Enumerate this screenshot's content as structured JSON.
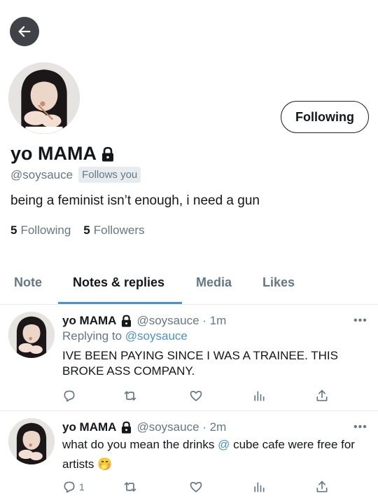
{
  "header": {
    "back_icon": "arrow-left-icon"
  },
  "profile": {
    "display_name": "yo MAMA",
    "locked_icon": "lock-icon",
    "handle": "@soysauce",
    "follows_you": "Follows you",
    "bio": "being a feminist isn’t enough, i need a gun",
    "following_count": "5",
    "following_label": "Following",
    "followers_count": "5",
    "followers_label": "Followers",
    "follow_button": "Following"
  },
  "tabs": [
    {
      "label": "Note",
      "active": false
    },
    {
      "label": "Notes & replies",
      "active": true
    },
    {
      "label": "Media",
      "active": false
    },
    {
      "label": "Likes",
      "active": false
    }
  ],
  "tweets": [
    {
      "name": "yo MAMA",
      "meta": "@soysauce · 1m",
      "reply_prefix": "Replying to",
      "reply_handle": "@soysauce",
      "text": "IVE BEEN PAYING SINCE I WAS A TRAINEE. THIS BROKE ASS COMPANY.",
      "reply_count": ""
    },
    {
      "name": "yo MAMA",
      "meta": "@soysauce · 2m",
      "text_before": "what do you mean the drinks",
      "text_mention": "@",
      "text_after": "cube cafe were free for artists",
      "emoji": "🤭",
      "reply_count": "1"
    }
  ],
  "more_label": "•••",
  "colors": {
    "accent": "#4a90d9",
    "muted": "#657786",
    "text": "#14171a",
    "back_button": "#3f4348"
  }
}
